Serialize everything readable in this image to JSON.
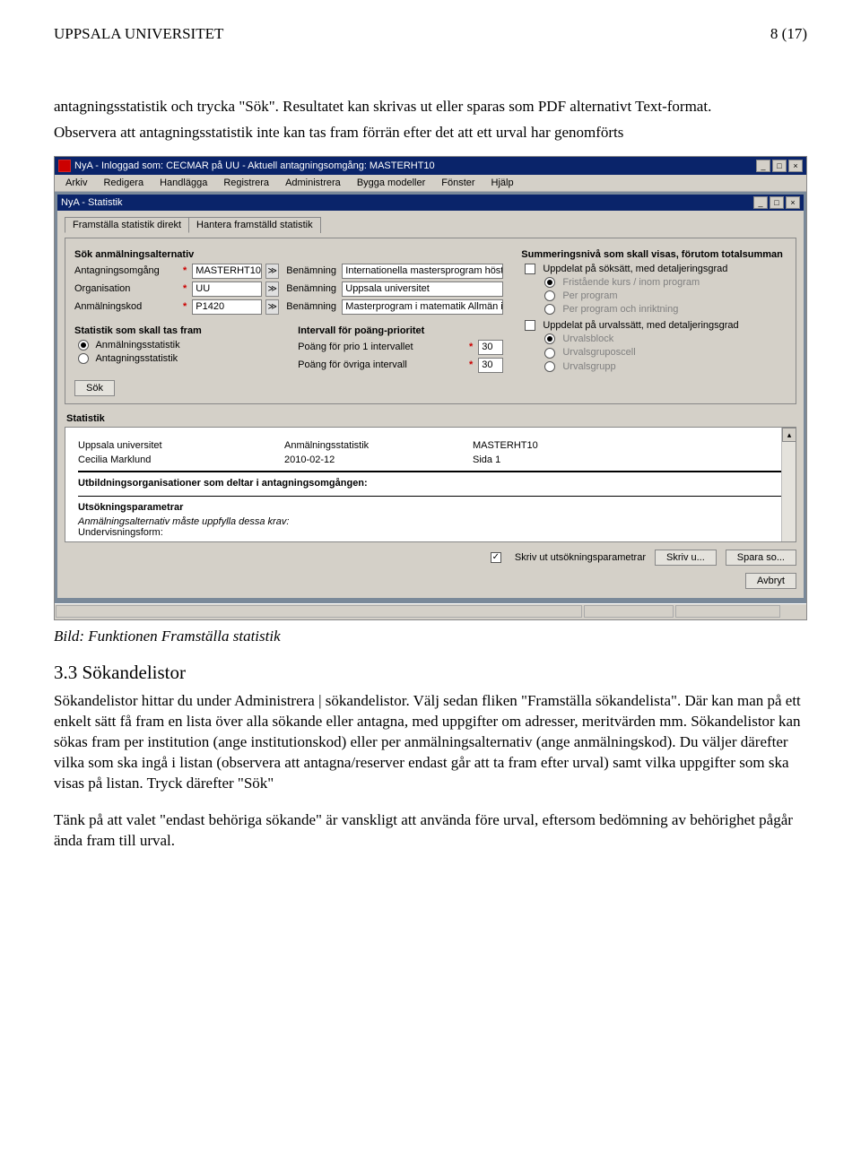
{
  "header": {
    "left": "UPPSALA UNIVERSITET",
    "right": "8 (17)"
  },
  "intro": {
    "p1": "antagningsstatistik och trycka \"Sök\". Resultatet kan skrivas ut eller sparas som PDF alternativt Text-format.",
    "p2": "Observera att antagningsstatistik inte kan tas fram förrän efter det att ett urval har genomförts"
  },
  "shot": {
    "title": "NyA - Inloggad som: CECMAR på UU - Aktuell antagningsomgång: MASTERHT10",
    "menu": [
      "Arkiv",
      "Redigera",
      "Handlägga",
      "Registrera",
      "Administrera",
      "Bygga modeller",
      "Fönster",
      "Hjälp"
    ],
    "sub_title": "NyA - Statistik",
    "tabs": [
      "Framställa statistik direkt",
      "Hantera framställd statistik"
    ],
    "search_head": "Sök anmälningsalternativ",
    "rows": [
      {
        "label": "Antagningsomgång",
        "req": true,
        "val": "MASTERHT10",
        "blabel": "Benämning",
        "bval": "Internationella mastersprogram hösttermin"
      },
      {
        "label": "Organisation",
        "req": true,
        "val": "UU",
        "blabel": "Benämning",
        "bval": "Uppsala universitet"
      },
      {
        "label": "Anmälningskod",
        "req": true,
        "val": "P1420",
        "blabel": "Benämning",
        "bval": "Masterprogram i matematik Allmän inriktning"
      }
    ],
    "stat_head": "Statistik som skall tas fram",
    "stat_opts": [
      {
        "t": "Anmälningsstatistik",
        "sel": true
      },
      {
        "t": "Antagningsstatistik",
        "sel": false
      }
    ],
    "interval_head": "Intervall för poäng-prioritet",
    "interval_rows": [
      {
        "label": "Poäng för prio 1 intervallet",
        "val": "30"
      },
      {
        "label": "Poäng för övriga intervall",
        "val": "30"
      }
    ],
    "sum_head": "Summeringsnivå som skall visas, förutom totalsumman",
    "sum_c1": "Uppdelat på söksätt, med detaljeringsgrad",
    "sum_c1_opts": [
      "Fristående kurs / inom program",
      "Per program",
      "Per program och inriktning"
    ],
    "sum_c2": "Uppdelat på urvalssätt, med detaljeringsgrad",
    "sum_c2_opts": [
      "Urvalsblock",
      "Urvalsgruposcell",
      "Urvalsgrupp"
    ],
    "sok_btn": "Sök",
    "stat_section": "Statistik",
    "stat_table": {
      "r1": [
        "Uppsala universitet",
        "Anmälningsstatistik",
        "MASTERHT10"
      ],
      "r2": [
        "Cecilia Marklund",
        "2010-02-12",
        "Sida 1"
      ],
      "h1": "Utbildningsorganisationer som deltar i antagningsomgången:",
      "h2": "Utsökningsparametrar",
      "h3": "Anmälningsalternativ måste uppfylla dessa krav:",
      "h4": "Undervisningsform:"
    },
    "footer": {
      "chk": "Skriv ut utsökningsparametrar",
      "b1": "Skriv u...",
      "b2": "Spara so...",
      "b3": "Avbryt"
    }
  },
  "caption": "Bild: Funktionen Framställa statistik",
  "section_head": "3.3 Sökandelistor",
  "para1": "Sökandelistor hittar du under Administrera | sökandelistor. Välj sedan fliken \"Framställa sökandelista\". Där kan man på ett enkelt sätt få fram en lista över alla sökande eller antagna, med uppgifter om adresser, meritvärden mm. Sökandelistor kan sökas fram per institution (ange institutionskod) eller per anmälningsalternativ (ange anmälningskod). Du väljer därefter vilka som ska ingå i listan (observera att antagna/reserver endast går att ta fram efter urval) samt vilka uppgifter som ska visas på listan.  Tryck därefter \"Sök\"",
  "para2": "Tänk på att valet \"endast behöriga sökande\" är vanskligt att använda före urval, eftersom bedömning av behörighet pågår ända fram till urval."
}
